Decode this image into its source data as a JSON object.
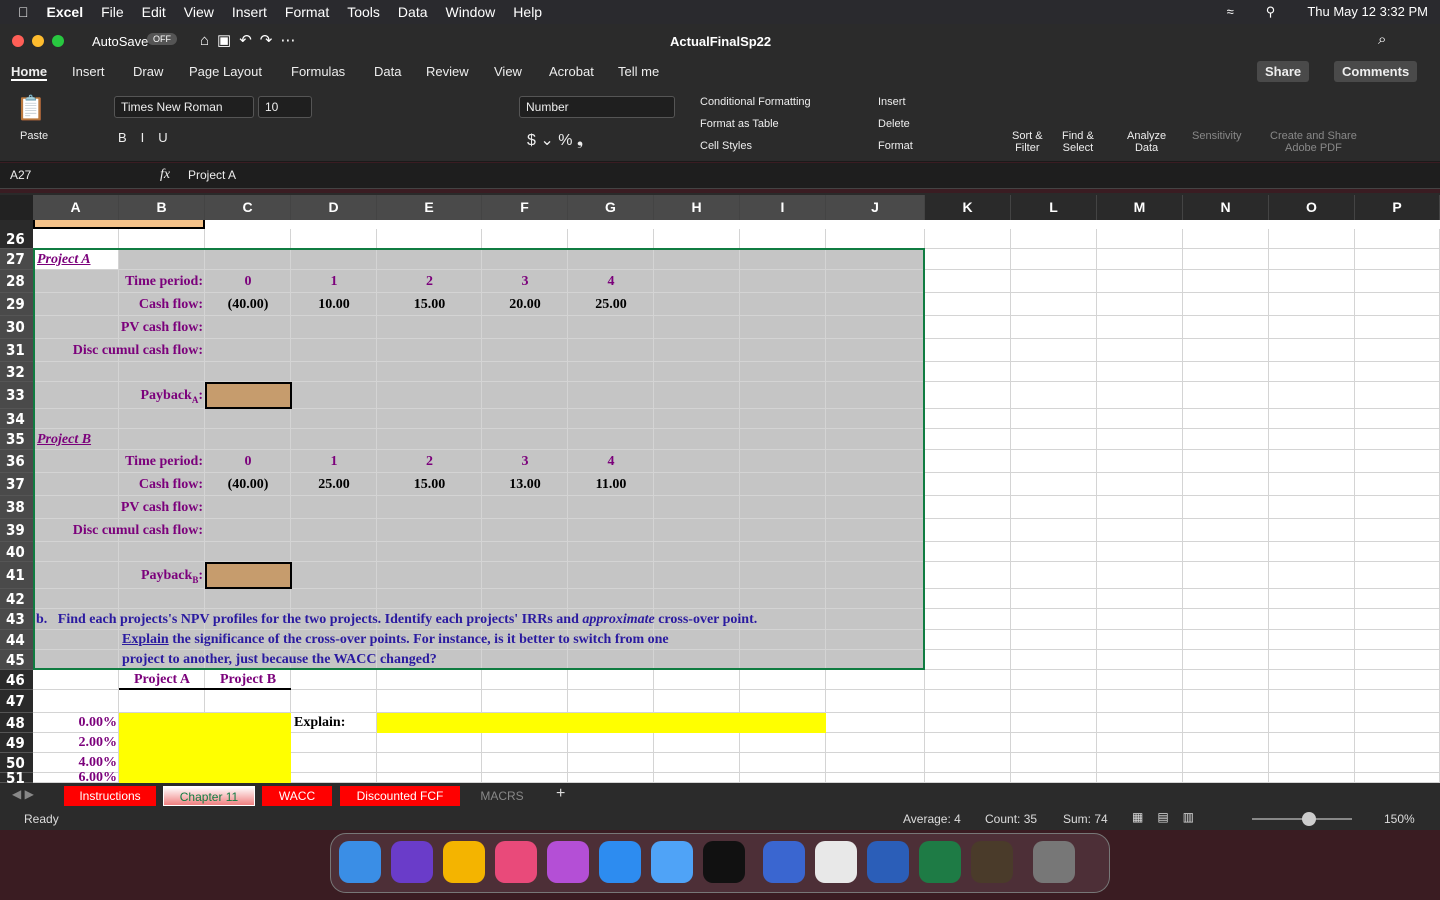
{
  "menubar": {
    "app": "Excel",
    "items": [
      "File",
      "Edit",
      "View",
      "Insert",
      "Format",
      "Tools",
      "Data",
      "Window",
      "Help"
    ],
    "clock": "Thu May 12  3:32 PM"
  },
  "titlebar": {
    "autosave": "AutoSave",
    "autosave_state": "OFF",
    "filename": "ActualFinalSp22"
  },
  "ribbon_tabs": [
    "Home",
    "Insert",
    "Draw",
    "Page Layout",
    "Formulas",
    "Data",
    "Review",
    "View",
    "Acrobat",
    "Tell me"
  ],
  "share": "Share",
  "comments": "Comments",
  "ribbon": {
    "paste": "Paste",
    "font": "Times New Roman",
    "size": "10",
    "number_format": "Number",
    "cond_fmt": "Conditional Formatting",
    "fmt_table": "Format as Table",
    "cell_styles": "Cell Styles",
    "insert": "Insert",
    "delete": "Delete",
    "format": "Format",
    "sort": "Sort &\nFilter",
    "find": "Find &\nSelect",
    "analyze": "Analyze\nData",
    "sensitivity": "Sensitivity",
    "adobe": "Create and Share\nAdobe PDF"
  },
  "formula_bar": {
    "name_box": "A27",
    "fx": "fx",
    "content": "Project A"
  },
  "columns": [
    "A",
    "B",
    "C",
    "D",
    "E",
    "F",
    "G",
    "H",
    "I",
    "J",
    "K",
    "L",
    "M",
    "N",
    "O",
    "P"
  ],
  "rows": [
    "26",
    "27",
    "28",
    "29",
    "30",
    "31",
    "32",
    "33",
    "34",
    "35",
    "36",
    "37",
    "38",
    "39",
    "40",
    "41",
    "42",
    "43",
    "44",
    "45",
    "46",
    "47",
    "48",
    "49",
    "50",
    "51"
  ],
  "cells": {
    "projA": "Project A",
    "tp": "Time period:",
    "cf": "Cash flow:",
    "pv": "PV cash flow:",
    "dc": "Disc cumul cash flow:",
    "paybackA": "Payback",
    "subA": "A",
    "colon": ":",
    "periods": [
      "0",
      "1",
      "2",
      "3",
      "4"
    ],
    "cashA": [
      "(40.00)",
      "10.00",
      "15.00",
      "20.00",
      "25.00"
    ],
    "projB": "Project B",
    "paybackB": "Payback",
    "subB": "B",
    "cashB": [
      "(40.00)",
      "25.00",
      "15.00",
      "13.00",
      "11.00"
    ],
    "q_b": "b.",
    "q1": "Find each projects's  NPV profiles for the two projects.  Identify each projects' IRRs and ",
    "q1i": "approximate",
    "q1e": "  cross-over point.",
    "q2u": "Explain",
    "q2": " the significance of the cross-over points.  For instance, is it better to switch from one",
    "q3": "project to another, just because the WACC changed?",
    "hdrA": "Project A",
    "hdrB": "Project B",
    "explain": "Explain:",
    "rates": [
      "0.00%",
      "2.00%",
      "4.00%",
      "6.00%"
    ]
  },
  "sheet_tabs": [
    "Instructions",
    "Chapter 11",
    "WACC",
    "Discounted FCF",
    "MACRS"
  ],
  "active_tab": "Chapter 11",
  "status": {
    "ready": "Ready",
    "average": "Average: 4",
    "count": "Count: 35",
    "sum": "Sum: 74",
    "zoom": "150%"
  },
  "colors": {
    "fill_gray": "#c5c5c5",
    "payback_fill": "#c69c6d",
    "yellow": "#ffff00",
    "label_purple": "#7b007b",
    "question_blue": "#2a1aa0",
    "selection": "#107c41"
  }
}
